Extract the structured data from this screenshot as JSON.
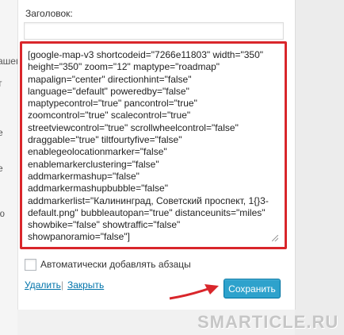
{
  "sidebar_fragments": [
    "ашег",
    "т",
    "е",
    "е",
    "ю"
  ],
  "widget": {
    "title_label": "Заголовок:",
    "title_value": "",
    "content_lines": [
      "[google-map-v3 shortcodeid=\"7266e11803\" width=\"350\"",
      "height=\"350\" zoom=\"12\" maptype=\"roadmap\"",
      "mapalign=\"center\" directionhint=\"false\"",
      "language=\"default\" poweredby=\"false\"",
      "maptypecontrol=\"true\" pancontrol=\"true\"",
      "zoomcontrol=\"true\" scalecontrol=\"true\"",
      "streetviewcontrol=\"true\" scrollwheelcontrol=\"false\"",
      "draggable=\"true\" tiltfourtyfive=\"false\"",
      "enablegeolocationmarker=\"false\"",
      "enablemarkerclustering=\"false\"",
      "addmarkermashup=\"false\"",
      "addmarkermashupbubble=\"false\"",
      "addmarkerlist=\"Калининград, Советский проспект, 1{}3-",
      "default.png\" bubbleautopan=\"true\" distanceunits=\"miles\"",
      "showbike=\"false\" showtraffic=\"false\"",
      "showpanoramio=\"false\"]"
    ],
    "auto_paragraph_label": "Автоматически добавлять абзацы",
    "auto_paragraph_checked": false,
    "delete_link": "Удалить",
    "separator": "|",
    "close_link": "Закрыть",
    "save_button": "Сохранить"
  },
  "watermark": "SMARTICLE.RU",
  "colors": {
    "highlight_border": "#d9262b",
    "arrow": "#d9262b",
    "save_button": "#2ea2cc",
    "link": "#0073aa"
  }
}
